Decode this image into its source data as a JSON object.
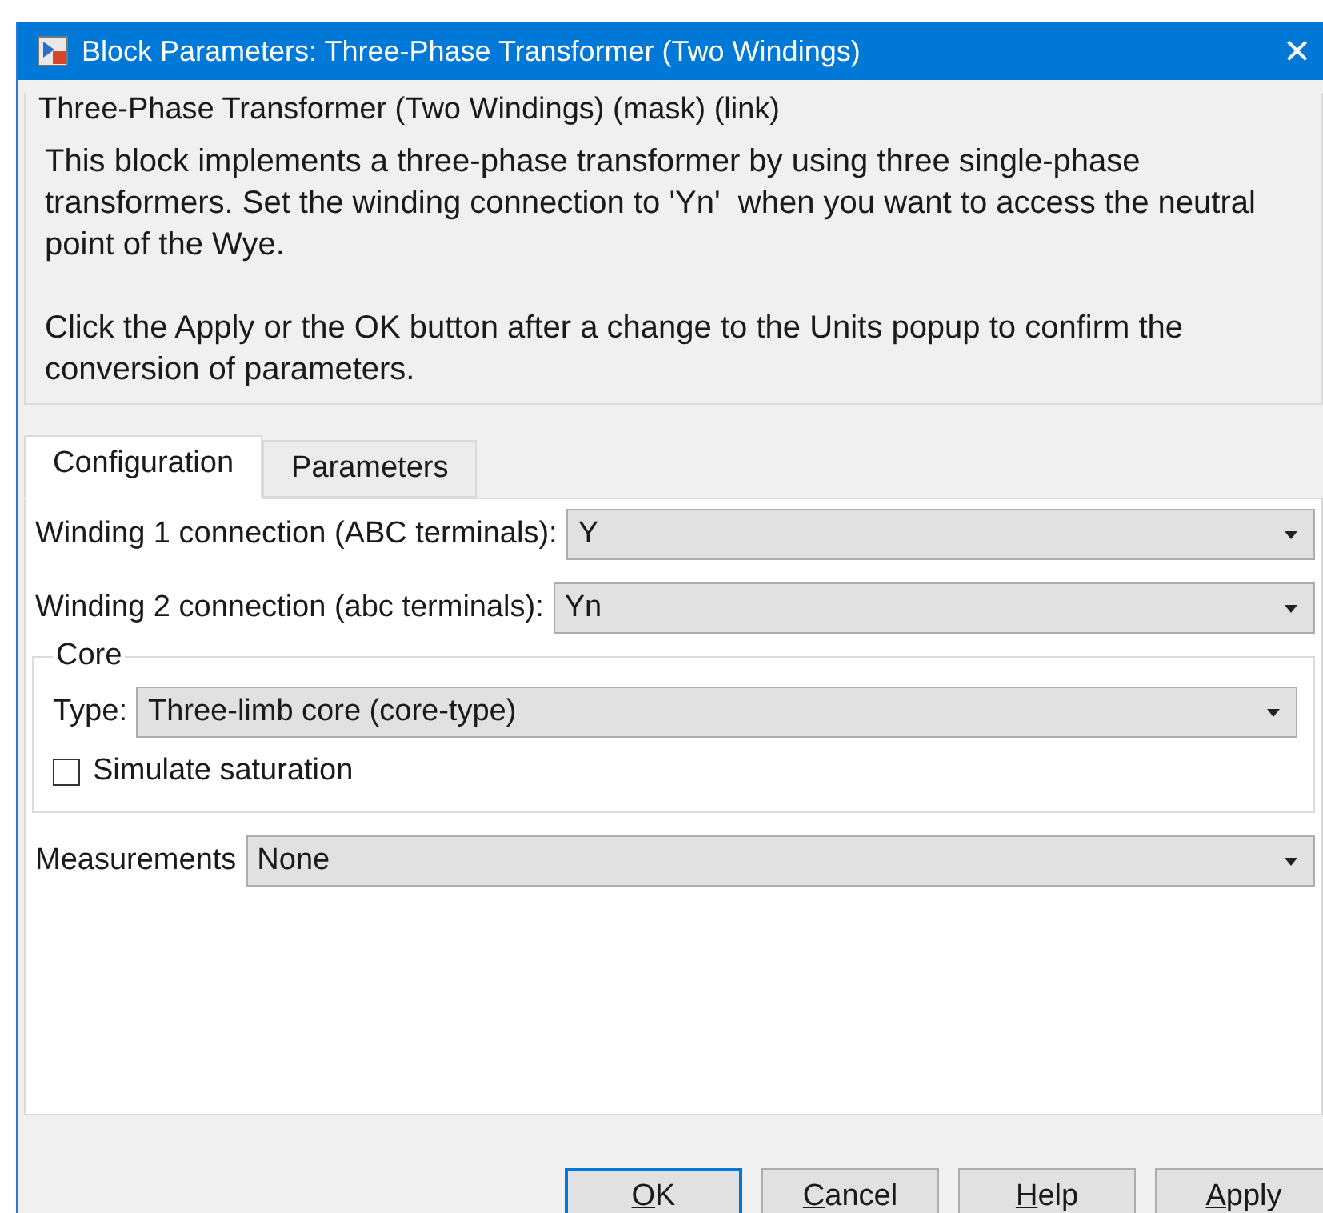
{
  "window": {
    "title": "Block Parameters: Three-Phase Transformer (Two Windings)",
    "close": "×"
  },
  "description": {
    "title": "Three-Phase Transformer (Two Windings) (mask) (link)",
    "paragraphs": [
      "This block implements a three-phase transformer by using three single-phase transformers. Set the winding connection to 'Yn'  when you want to access the neutral point of the Wye.",
      "Click the Apply or the OK button after a change to the Units popup to confirm the conversion of parameters."
    ]
  },
  "tabs": [
    {
      "label": "Configuration",
      "selected": true
    },
    {
      "label": "Parameters",
      "selected": false
    }
  ],
  "fields": [
    {
      "kind": "dropdown",
      "label": "Winding 1 connection (ABC terminals):",
      "value": "Y"
    },
    {
      "kind": "dropdown",
      "label": "Winding 2 connection (abc terminals):",
      "value": "Yn"
    },
    {
      "kind": "group",
      "title": "Core",
      "children": [
        {
          "kind": "dropdown",
          "label": "Type:",
          "value": "Three-limb core (core-type)"
        },
        {
          "kind": "checkbox",
          "label": "Simulate saturation",
          "checked": false
        }
      ]
    },
    {
      "kind": "dropdown",
      "label": "Measurements",
      "value": "None"
    }
  ],
  "buttons": [
    {
      "label": "OK",
      "default": true
    },
    {
      "label": "Cancel",
      "default": false
    },
    {
      "label": "Help",
      "default": false
    },
    {
      "label": "Apply",
      "default": false
    }
  ]
}
